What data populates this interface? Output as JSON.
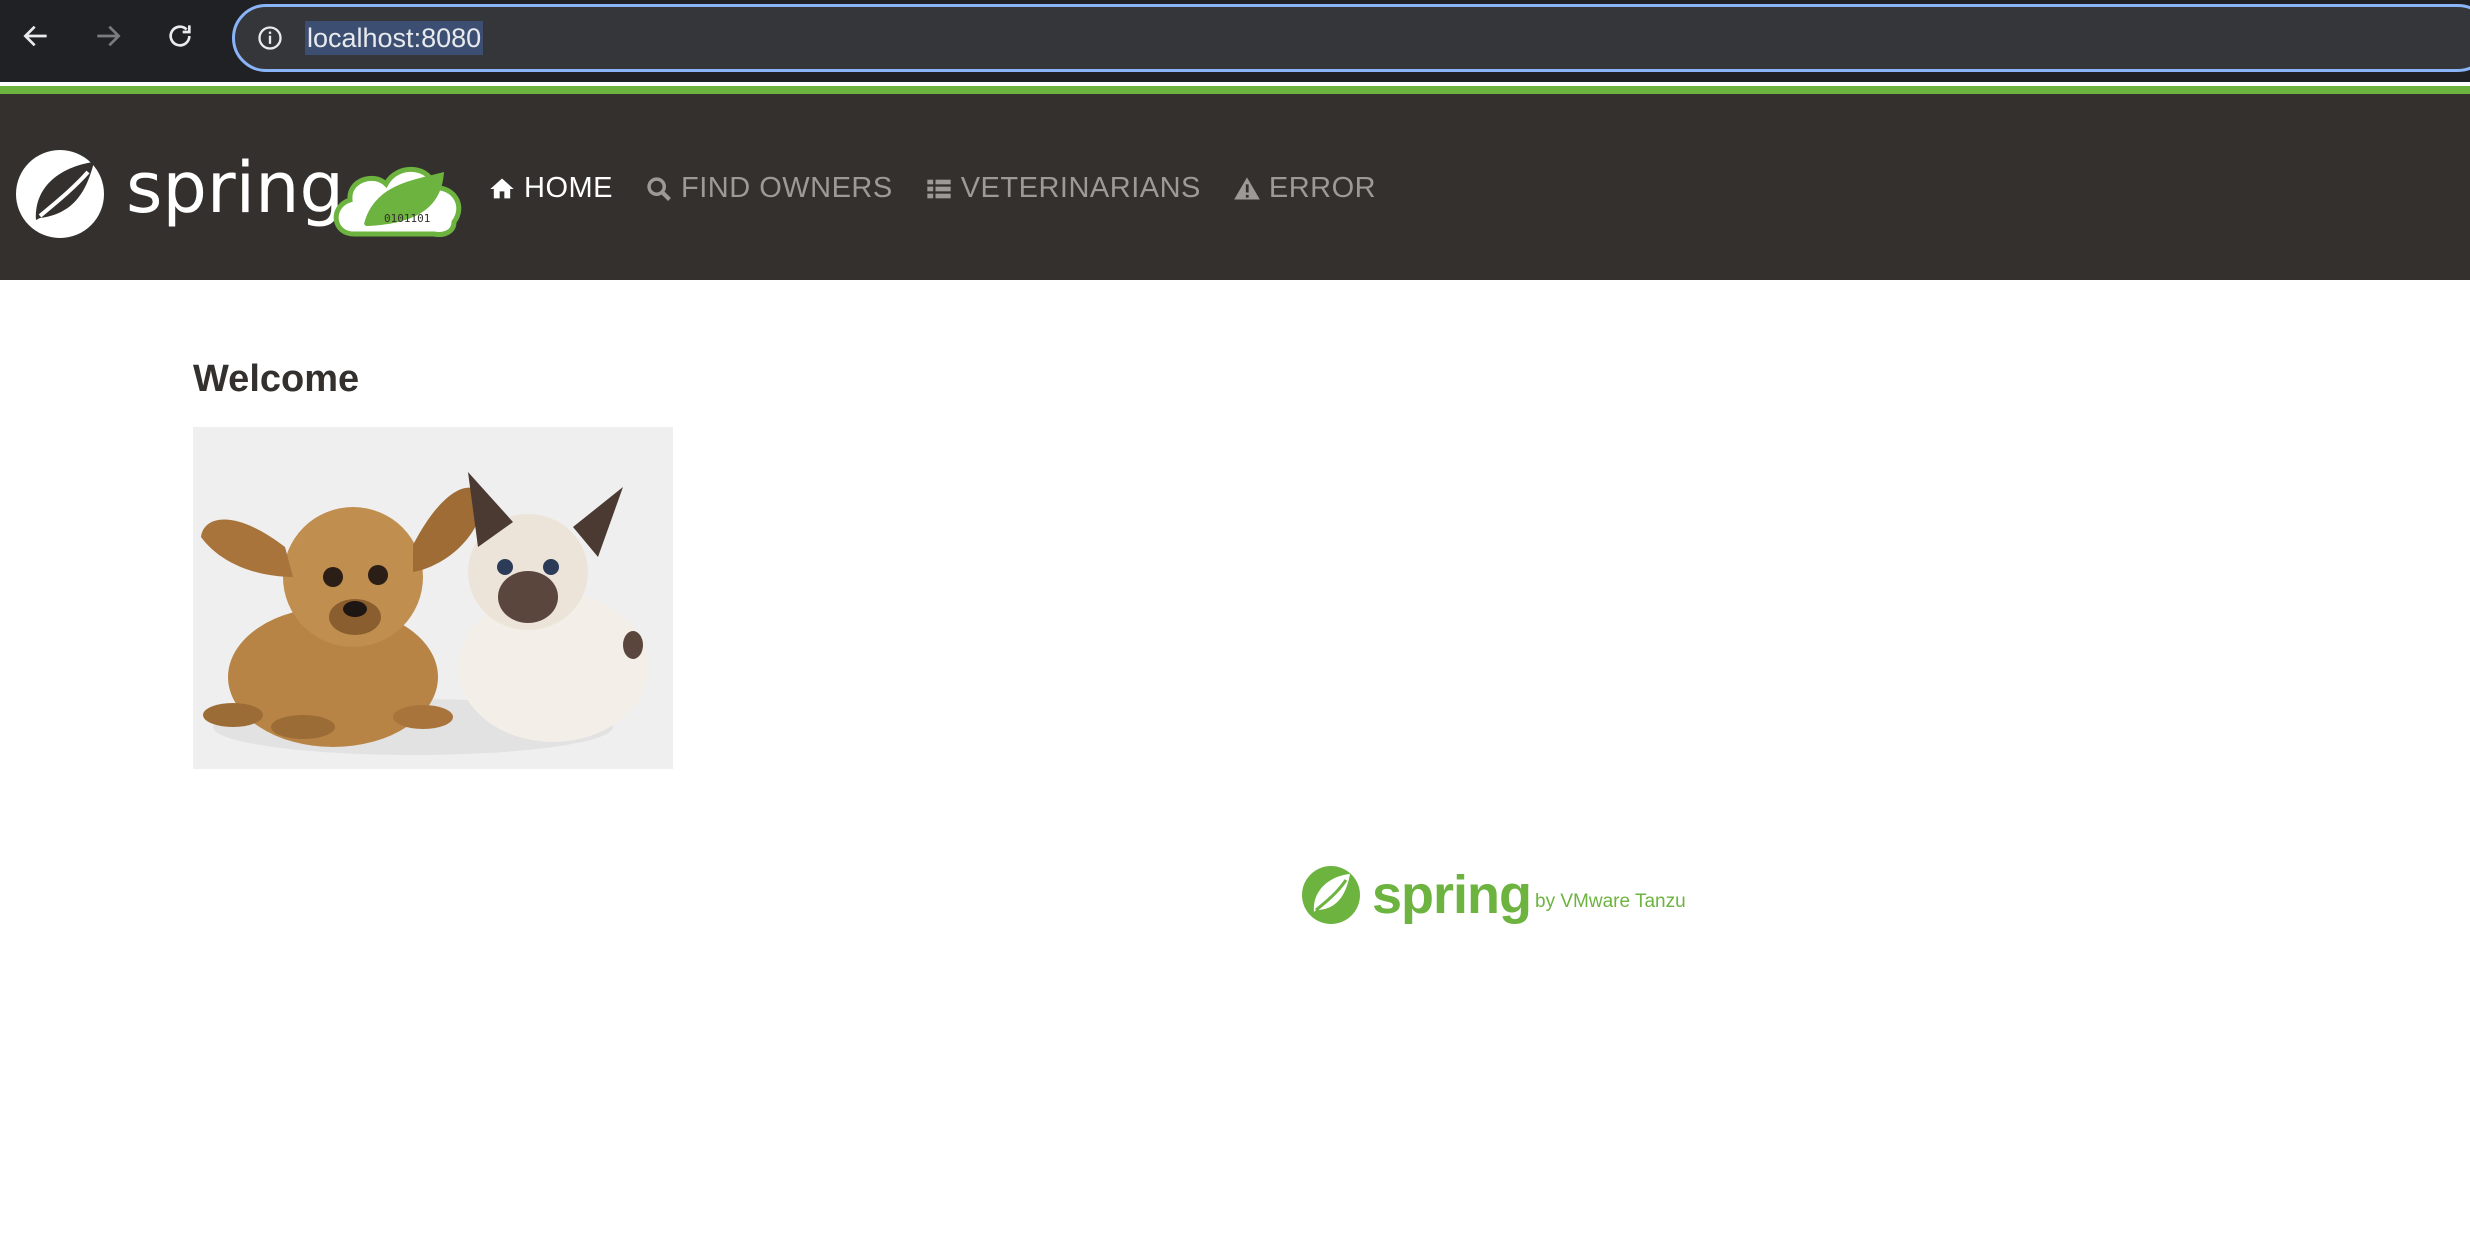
{
  "browser": {
    "url": "localhost:8080",
    "back_icon": "arrow-left-icon",
    "forward_icon": "arrow-right-icon",
    "reload_icon": "reload-icon",
    "info_icon": "info-icon"
  },
  "header": {
    "brand_text": "spring",
    "menu": [
      {
        "label": "HOME",
        "icon": "home-icon",
        "active": true
      },
      {
        "label": "FIND OWNERS",
        "icon": "search-icon",
        "active": false
      },
      {
        "label": "VETERINARIANS",
        "icon": "list-icon",
        "active": false
      },
      {
        "label": "ERROR",
        "icon": "warning-icon",
        "active": false
      }
    ]
  },
  "main": {
    "title": "Welcome",
    "image_alt": "pets-photo"
  },
  "footer": {
    "brand": "spring",
    "tagline": "by VMware Tanzu"
  },
  "colors": {
    "brand_green": "#6db33f",
    "header_bg": "#34302d",
    "menu_inactive": "#9d9995"
  }
}
